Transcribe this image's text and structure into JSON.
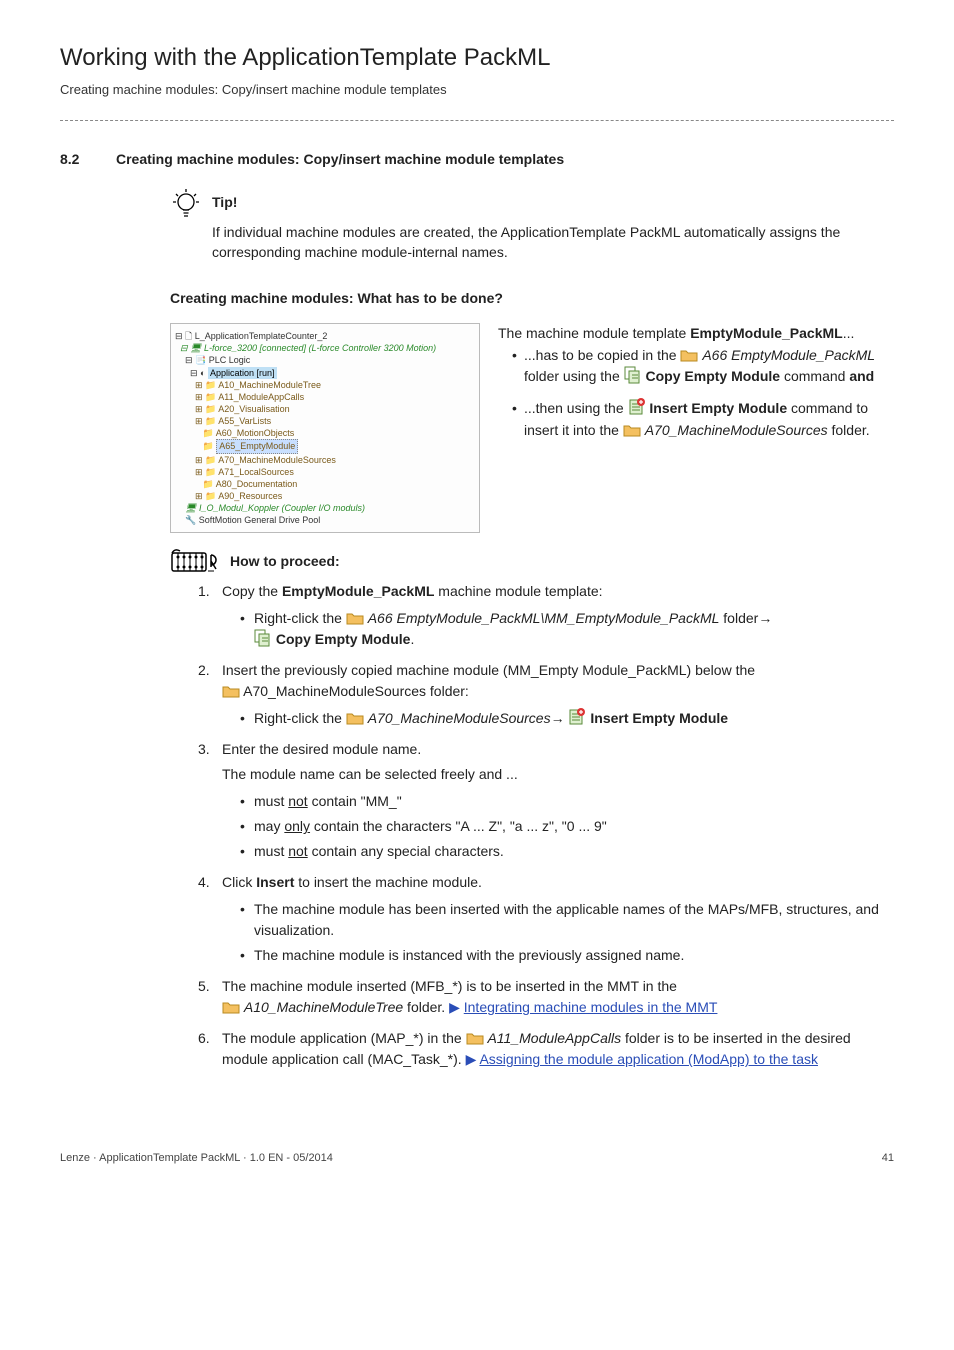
{
  "header": {
    "title": "Working with the ApplicationTemplate PackML",
    "subtitle": "Creating machine modules: Copy/insert machine module templates"
  },
  "section": {
    "number": "8.2",
    "title": "Creating machine modules: Copy/insert machine module templates"
  },
  "tip": {
    "label": "Tip!",
    "body": "If individual machine modules are created, the ApplicationTemplate PackML automatically assigns the corresponding machine module-internal names."
  },
  "subheading": "Creating machine modules: What has to be done?",
  "tree": {
    "root": "L_ApplicationTemplateCounter_2",
    "device": "L-force_3200 [connected] (L-force Controller 3200 Motion)",
    "plc": "PLC Logic",
    "app": "Application [run]",
    "items": [
      "A10_MachineModuleTree",
      "A11_ModuleAppCalls",
      "A20_Visualisation",
      "A55_VarLists",
      "A60_MotionObjects",
      "A65_EmptyModule",
      "A70_MachineModuleSources",
      "A71_LocalSources",
      "A80_Documentation",
      "A90_Resources"
    ],
    "coupler": "I_O_Modul_Koppler (Coupler I/O moduls)",
    "softmotion": "SoftMotion General Drive Pool"
  },
  "intro": {
    "lead": "The machine module template ",
    "lead_bold": "EmptyModule_PackML",
    "lead_tail": "...",
    "bullets": [
      {
        "pre": "...has to be copied in the ",
        "folder": "A66 EmptyModule_PackML",
        "mid": " folder using the ",
        "cmd": "Copy Empty Module",
        "post": " command ",
        "and": "and"
      },
      {
        "pre": "...then using the ",
        "cmd": "Insert Empty Module",
        "mid": " command to insert it into the ",
        "folder": "A70_MachineModuleSources",
        "post": " folder."
      }
    ]
  },
  "howto": {
    "label": "How to proceed:",
    "step1": {
      "text_a": "Copy the ",
      "bold": "EmptyModule_PackML",
      "text_b": " machine module template:",
      "sub_pre": "Right-click the ",
      "sub_path": "A66 EmptyModule_PackML\\MM_EmptyModule_PackML",
      "sub_post": " folder",
      "cmd": "Copy Empty Module"
    },
    "step2": {
      "text": "Insert the previously copied machine module (MM_Empty Module_PackML) below the ",
      "folder": "A70_MachineModuleSources folder:",
      "sub_pre": "Right-click the ",
      "sub_path": "A70_MachineModuleSources",
      "cmd": "Insert Empty Module"
    },
    "step3": {
      "text": "Enter the desired module name.",
      "note": "The module name can be selected freely and ...",
      "b1_a": "must ",
      "b1_u": "not",
      "b1_b": " contain \"MM_\"",
      "b2_a": "may ",
      "b2_u": "only",
      "b2_b": " contain the characters \"A ... Z\", \"a ... z\", \"0 ... 9\"",
      "b3_a": "must ",
      "b3_u": "not",
      "b3_b": " contain any special characters."
    },
    "step4": {
      "text_a": "Click ",
      "bold": "Insert",
      "text_b": " to insert the machine module.",
      "b1": "The machine module has been inserted with the applicable names of the MAPs/MFB, structures, and visualization.",
      "b2": "The machine module is instanced with the previously assigned name."
    },
    "step5": {
      "text": "The machine module inserted (MFB_*) is to be inserted in the MMT in the ",
      "folder": "A10_MachineModuleTree",
      "post": " folder.  ",
      "link": "Integrating machine modules in the MMT"
    },
    "step6": {
      "text_a": "The module application (MAP_*) in the ",
      "folder": "A11_ModuleAppCalls",
      "text_b": " folder is to be inserted in the desired module application call (MAC_Task_*).  ",
      "link": "Assigning the module application (ModApp) to the task"
    }
  },
  "footer": {
    "left": "Lenze · ApplicationTemplate PackML · 1.0 EN - 05/2014",
    "right": "41"
  }
}
